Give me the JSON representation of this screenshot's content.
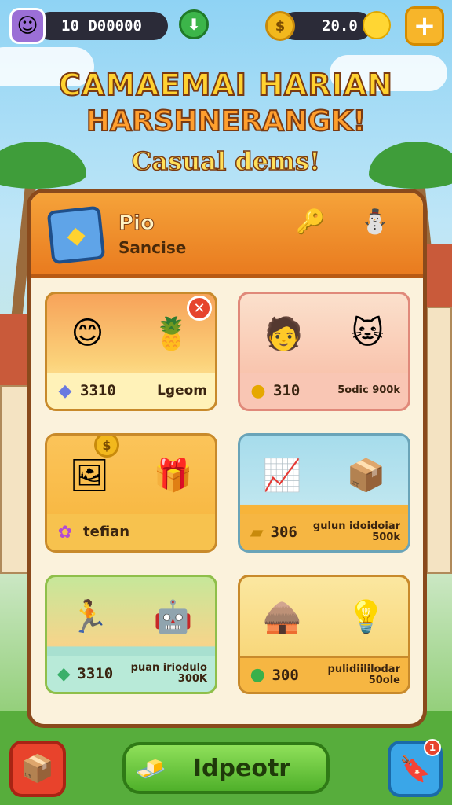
{
  "top_bar": {
    "avatar_icon": "avatar-face",
    "balance_left": "10 D00000",
    "download_icon": "download-arrow",
    "coins": "20.0",
    "plus_label": "+"
  },
  "title": {
    "line1": "CAMAEMAI HARIAN",
    "line2": "HARSHNERANGK!",
    "line3": "Casual dems!"
  },
  "panel": {
    "header_title": "Pio",
    "header_subtitle": "Sancise",
    "cards": [
      {
        "value": "3310",
        "label": "Lgeom",
        "icon": "gem"
      },
      {
        "value": "310",
        "label": "5odic 900k",
        "icon": "gold-nugget"
      },
      {
        "value": "",
        "label": "tefian",
        "icon": "flower"
      },
      {
        "value": "306",
        "label": "gulun idoidoiar 500k",
        "icon": "gold-bars"
      },
      {
        "value": "3310",
        "label": "puan iriodulo 300K",
        "icon": "green-gem"
      },
      {
        "value": "300",
        "label": "pulidiililodar 50ole",
        "icon": "green-orb"
      }
    ]
  },
  "bottom": {
    "main_label": "Idpeotr",
    "notification_count": "1"
  },
  "colors": {
    "panel_border": "#8a4a1c",
    "header_orange": "#e97b1f",
    "main_button": "#4fb02a"
  }
}
